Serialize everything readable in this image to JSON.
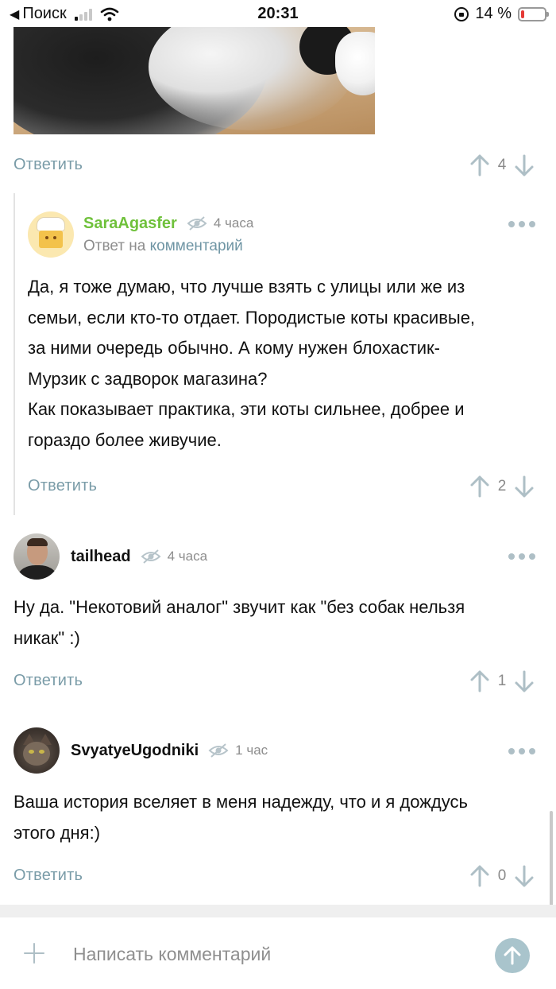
{
  "status_bar": {
    "back_label": "Поиск",
    "time": "20:31",
    "battery_percent": "14 %",
    "battery_level": 0.14,
    "signal_bars_active": 1,
    "signal_bars_total": 4
  },
  "comments": [
    {
      "reply_label": "Ответить",
      "rating": "4"
    },
    {
      "username": "SaraAgasfer",
      "time": "4 часа",
      "reply_prefix": "Ответ на",
      "reply_target": "комментарий",
      "text_lines": [
        "Да, я тоже думаю, что лучше взять с улицы или же из",
        "семьи, если кто-то отдает. Породистые коты красивые,",
        "за ними очередь обычно. А кому нужен блохастик-",
        "Мурзик с задворок магазина?",
        "Как показывает практика, эти коты сильнее, добрее и",
        "гораздо более живучие."
      ],
      "reply_label": "Ответить",
      "rating": "2"
    },
    {
      "username": "tailhead",
      "time": "4 часа",
      "text_lines": [
        "Ну да. \"Некотовий аналог\" звучит как \"без собак нельзя",
        "никак\" :)"
      ],
      "reply_label": "Ответить",
      "rating": "1"
    },
    {
      "username": "SvyatyeUgodniki",
      "time": "1 час",
      "text_lines": [
        "Ваша история вселяет в меня надежду, что и я дождусь",
        "этого дня:)"
      ],
      "reply_label": "Ответить",
      "rating": "0"
    }
  ],
  "composer": {
    "placeholder": "Написать комментарий"
  },
  "colors": {
    "link": "#7a9ca8",
    "username_highlight": "#6fc13b",
    "icon_muted": "#aebfc6",
    "send_button": "#a9c4cc",
    "battery_low": "#e53935"
  }
}
